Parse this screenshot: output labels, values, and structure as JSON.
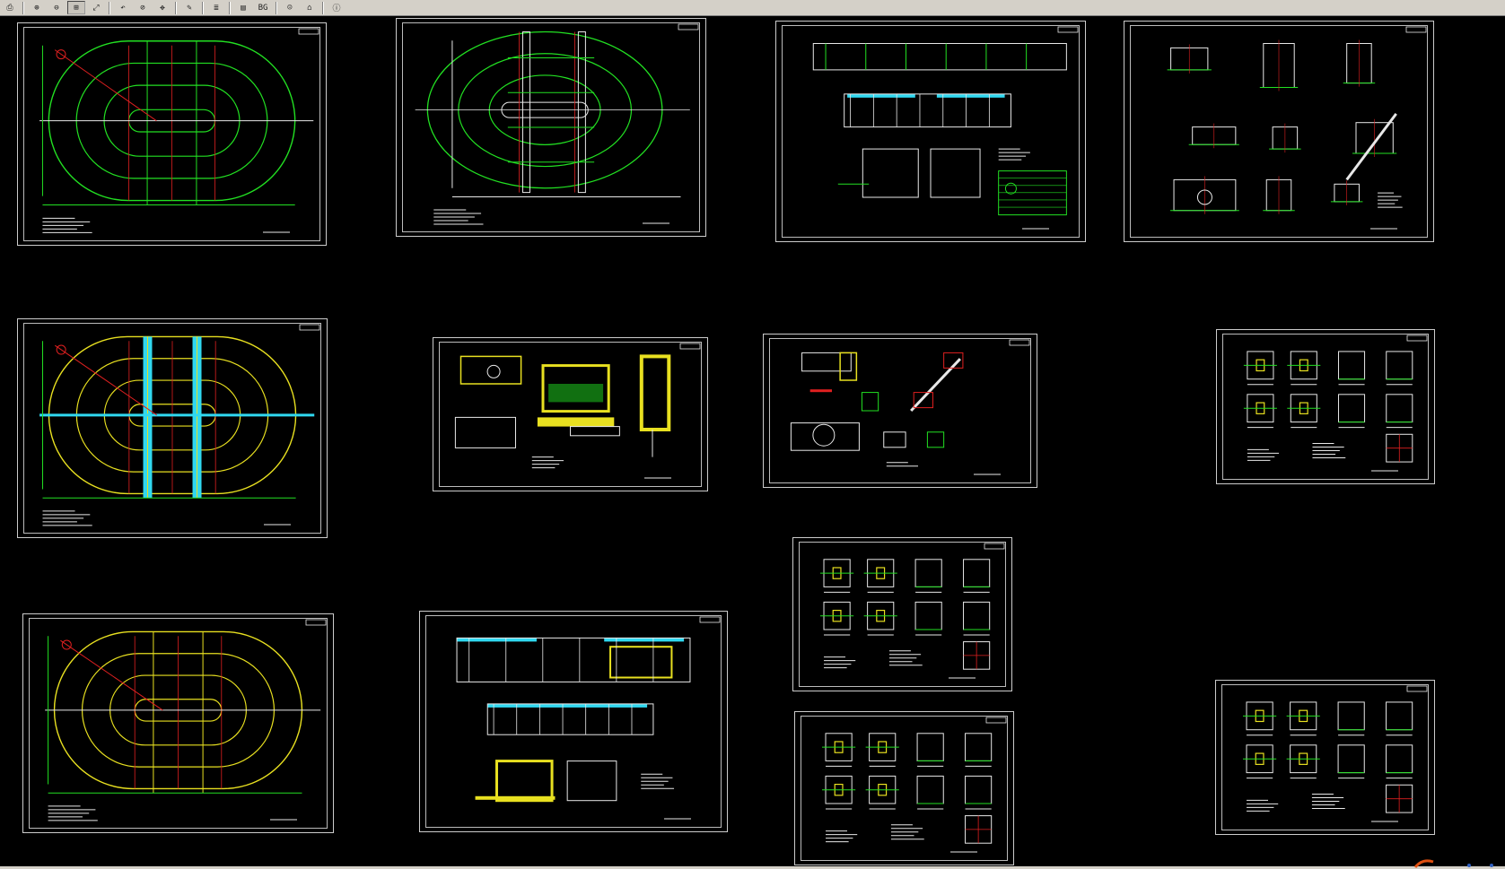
{
  "toolbar": {
    "buttons": [
      {
        "name": "print-icon",
        "glyph": "⎙"
      },
      {
        "name": "sep"
      },
      {
        "name": "zoom-in-icon",
        "glyph": "⊕"
      },
      {
        "name": "zoom-out-icon",
        "glyph": "⊖"
      },
      {
        "name": "zoom-window-icon",
        "glyph": "⊞",
        "active": true
      },
      {
        "name": "zoom-extents-icon",
        "glyph": "⤢"
      },
      {
        "name": "sep"
      },
      {
        "name": "zoom-previous-icon",
        "glyph": "↶"
      },
      {
        "name": "zoom-realtime-icon",
        "glyph": "⊘"
      },
      {
        "name": "pan-icon",
        "glyph": "✥"
      },
      {
        "name": "sep"
      },
      {
        "name": "highlight-icon",
        "glyph": "✎"
      },
      {
        "name": "sep"
      },
      {
        "name": "layers-icon",
        "glyph": "≣"
      },
      {
        "name": "sep"
      },
      {
        "name": "page-icon",
        "glyph": "▤"
      },
      {
        "name": "background-label",
        "glyph": "BG"
      },
      {
        "name": "sep"
      },
      {
        "name": "user-icon",
        "glyph": "☺"
      },
      {
        "name": "home-icon",
        "glyph": "⌂"
      },
      {
        "name": "sep"
      },
      {
        "name": "info-icon",
        "glyph": "ⓘ"
      }
    ]
  },
  "colors": {
    "canvas": "#000000",
    "frame": "#cfcfcf",
    "green": "#22e022",
    "yellow": "#e8e020",
    "red": "#e02020",
    "cyan": "#30d8f0",
    "white": "#e8e8e8",
    "magenta": "#e040e0"
  },
  "sheets": [
    {
      "id": "track-plan-1",
      "type": "track",
      "ring": "green"
    },
    {
      "id": "track-plan-2",
      "type": "track2",
      "ring": "green"
    },
    {
      "id": "section-1",
      "type": "section"
    },
    {
      "id": "details-1",
      "type": "details"
    },
    {
      "id": "track-plan-3",
      "type": "track",
      "ring": "yellow",
      "cyan": true
    },
    {
      "id": "pump-details",
      "type": "pump"
    },
    {
      "id": "details-2",
      "type": "details2"
    },
    {
      "id": "details-3",
      "type": "details3"
    },
    {
      "id": "details-4",
      "type": "details3"
    },
    {
      "id": "track-plan-4",
      "type": "track",
      "ring": "yellow"
    },
    {
      "id": "section-2",
      "type": "section2"
    },
    {
      "id": "details-5",
      "type": "details3"
    },
    {
      "id": "details-6",
      "type": "details3"
    }
  ]
}
